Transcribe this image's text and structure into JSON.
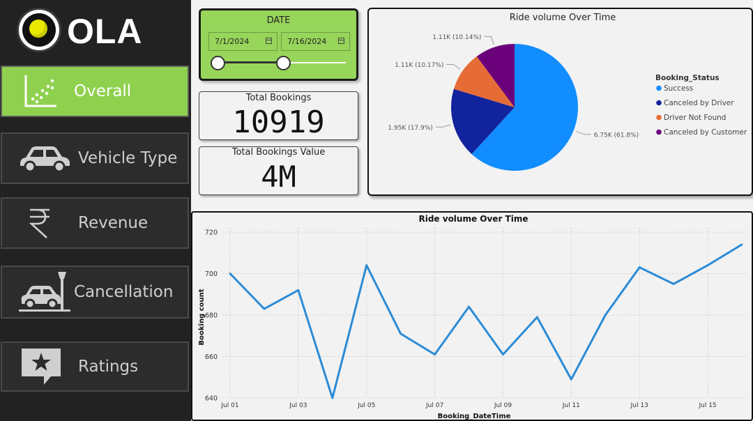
{
  "brand": {
    "logo_text": "OLA",
    "accent": "#8fd14f"
  },
  "sidebar": {
    "items": [
      {
        "label": "Overall",
        "icon": "scatter-chart-icon",
        "active": true
      },
      {
        "label": "Vehicle Type",
        "icon": "car-icon",
        "active": false
      },
      {
        "label": "Revenue",
        "icon": "rupee-icon",
        "active": false
      },
      {
        "label": "Cancellation",
        "icon": "car-crash-icon",
        "active": false
      },
      {
        "label": "Ratings",
        "icon": "star-icon",
        "active": false
      }
    ]
  },
  "date_slicer": {
    "title": "DATE",
    "start": "7/1/2024",
    "end": "7/16/2024",
    "range_start_fraction": 0,
    "range_end_fraction": 0.5
  },
  "cards": {
    "total_bookings": {
      "label": "Total Bookings",
      "value": "10919"
    },
    "total_value": {
      "label": "Total Bookings Value",
      "value": "4M"
    }
  },
  "chart_data": [
    {
      "type": "pie",
      "title": "Ride volume Over Time",
      "legend_title": "Booking_Status",
      "legend_position": "right",
      "slices": [
        {
          "name": "Success",
          "value": 6750,
          "label": "6.75K (61.8%)",
          "color": "#118dff"
        },
        {
          "name": "Canceled by Driver",
          "value": 1950,
          "label": "1.95K (17.9%)",
          "color": "#12239e"
        },
        {
          "name": "Driver Not Found",
          "value": 1110,
          "label": "1.11K (10.17%)",
          "color": "#e66c37"
        },
        {
          "name": "Canceled by Customer",
          "value": 1110,
          "label": "1.11K (10.14%)",
          "color": "#6b007b"
        }
      ]
    },
    {
      "type": "line",
      "title": "Ride volume Over Time",
      "xlabel": "Booking_DateTime",
      "ylabel": "Booking count",
      "ylim": [
        640,
        720
      ],
      "yticks": [
        640,
        660,
        680,
        700,
        720
      ],
      "grid": true,
      "color": "#2b8bd6",
      "x": [
        "Jul 01",
        "Jul 02",
        "Jul 03",
        "Jul 04",
        "Jul 05",
        "Jul 06",
        "Jul 07",
        "Jul 08",
        "Jul 09",
        "Jul 10",
        "Jul 11",
        "Jul 12",
        "Jul 13",
        "Jul 14",
        "Jul 15",
        "Jul 16"
      ],
      "x_tick_labels": [
        "Jul 01",
        "",
        "Jul 03",
        "",
        "Jul 05",
        "",
        "Jul 07",
        "",
        "Jul 09",
        "",
        "Jul 11",
        "",
        "Jul 13",
        "",
        "Jul 15",
        ""
      ],
      "values": [
        700,
        683,
        692,
        640,
        704,
        671,
        661,
        684,
        661,
        679,
        649,
        680,
        703,
        695,
        704,
        714
      ]
    }
  ]
}
